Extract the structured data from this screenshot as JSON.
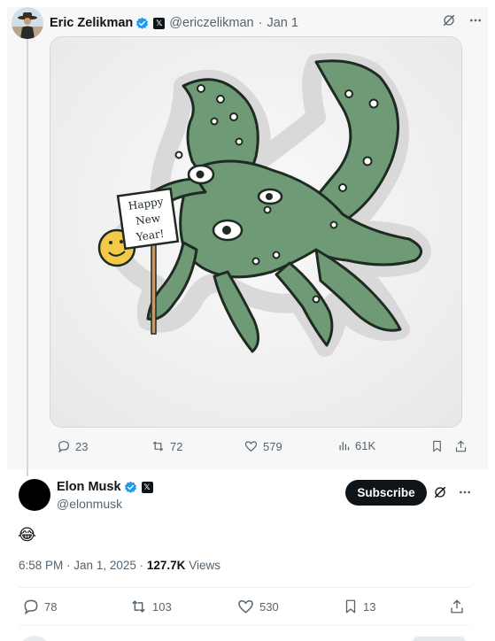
{
  "quoted_post": {
    "author_name": "Eric Zelikman",
    "author_handle": "@ericzelikman",
    "separator": "·",
    "date": "Jan 1",
    "verified": true,
    "affiliate_badge": "𝕏",
    "media_alt": "Drawing of a green octopus creature holding a sign reading Happy New Year! with a yellow smiley face",
    "sign_text_lines": [
      "Happy",
      "New",
      "Year!"
    ],
    "stats": {
      "replies": "23",
      "reposts": "72",
      "likes": "579",
      "views": "61K"
    }
  },
  "post": {
    "author_name": "Elon Musk",
    "author_handle": "@elonmusk",
    "verified": true,
    "affiliate_badge": "𝕏",
    "subscribe_label": "Subscribe",
    "text": "😂",
    "time": "6:58 PM",
    "date": "Jan 1, 2025",
    "views_count": "127.7K",
    "views_label": "Views",
    "stats": {
      "replies": "78",
      "reposts": "103",
      "likes": "530",
      "bookmarks": "13"
    }
  },
  "colors": {
    "accent_blue": "#1d9bf0",
    "muted_text": "#536471",
    "octopus_green": "#6f9a76"
  }
}
